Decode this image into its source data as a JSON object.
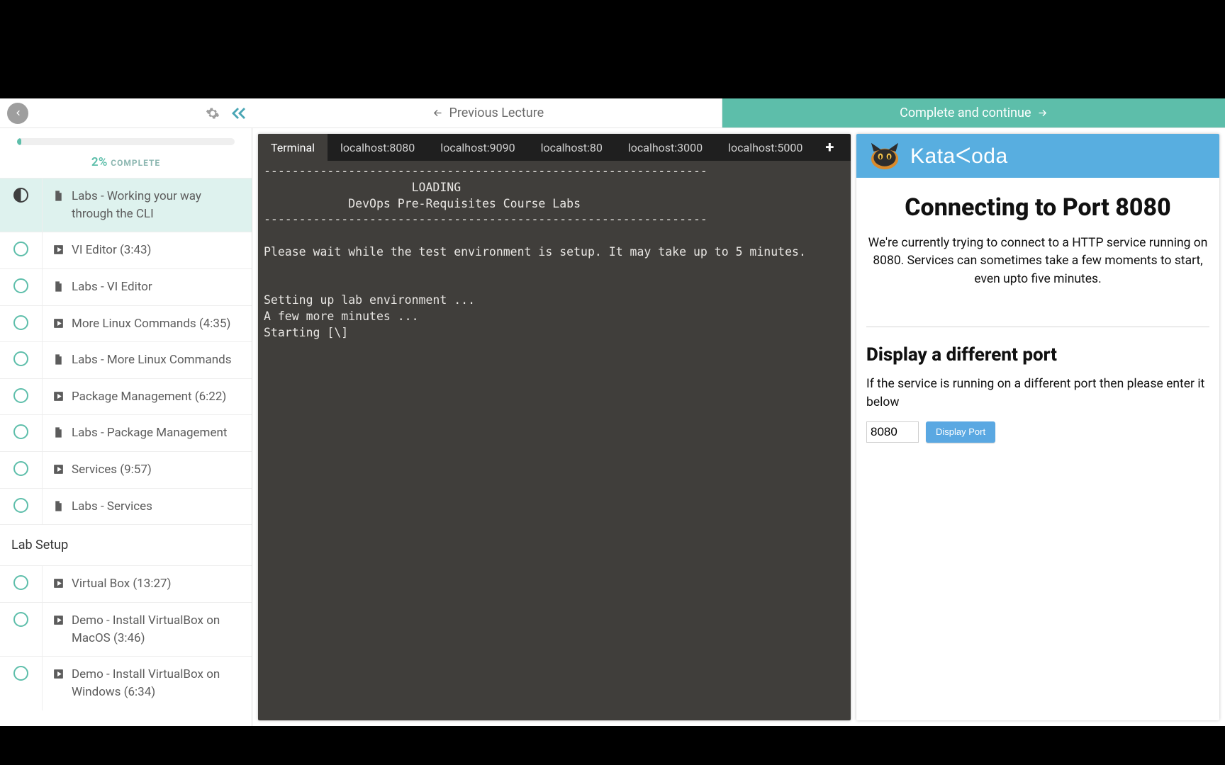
{
  "topbar": {
    "prev_label": "Previous Lecture",
    "complete_label": "Complete and continue"
  },
  "sidebar": {
    "progress_percent": "2%",
    "progress_word": "COMPLETE",
    "items": [
      {
        "type": "doc",
        "label": "Labs - Working your way through the CLI",
        "status": "current"
      },
      {
        "type": "video",
        "label": "VI Editor (3:43)"
      },
      {
        "type": "doc",
        "label": "Labs - VI Editor"
      },
      {
        "type": "video",
        "label": "More Linux Commands (4:35)"
      },
      {
        "type": "doc",
        "label": "Labs - More Linux Commands"
      },
      {
        "type": "video",
        "label": "Package Management (6:22)"
      },
      {
        "type": "doc",
        "label": "Labs - Package Management"
      },
      {
        "type": "video",
        "label": "Services (9:57)"
      },
      {
        "type": "doc",
        "label": "Labs - Services"
      }
    ],
    "section2_title": "Lab Setup",
    "section2_items": [
      {
        "type": "video",
        "label": "Virtual Box (13:27)"
      },
      {
        "type": "video",
        "label": "Demo - Install VirtualBox on MacOS (3:46)"
      },
      {
        "type": "video",
        "label": "Demo - Install VirtualBox on Windows (6:34)"
      }
    ]
  },
  "tabs": [
    "Terminal",
    "localhost:8080",
    "localhost:9090",
    "localhost:80",
    "localhost:3000",
    "localhost:5000"
  ],
  "terminal_text": "---------------------------------------------------------------\n                     LOADING\n            DevOps Pre-Requisites Course Labs\n---------------------------------------------------------------\n\nPlease wait while the test environment is setup. It may take up to 5 minutes.\n\n\nSetting up lab environment ...\nA few more minutes ...\nStarting [\\]",
  "right": {
    "brand": "Kataᐸoda",
    "h1": "Connecting to Port 8080",
    "lead": "We're currently trying to connect to a HTTP service running on 8080. Services can sometimes take a few moments to start, even upto five minutes.",
    "h2": "Display a different port",
    "sub": "If the service is running on a different port then please enter it below",
    "port_value": "8080",
    "port_btn": "Display Port"
  }
}
